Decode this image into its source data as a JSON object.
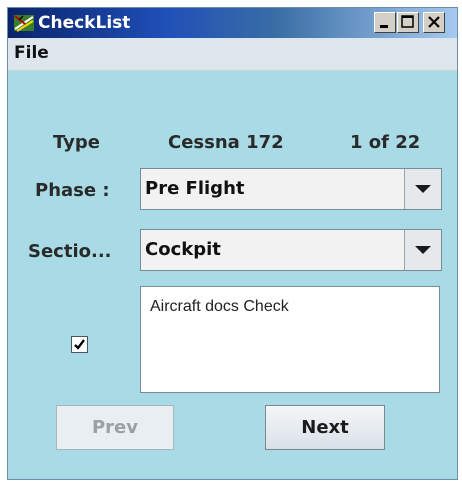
{
  "window": {
    "title": "CheckList",
    "buttons": {
      "minimize": "minimize-icon",
      "maximize": "maximize-icon",
      "close": "close-icon"
    }
  },
  "menu": {
    "file": "File"
  },
  "info": {
    "type_label": "Type",
    "aircraft": "Cessna 172",
    "progress": "1 of 22"
  },
  "phase": {
    "label": "Phase :",
    "value": "Pre Flight"
  },
  "section": {
    "label": "Sectio...",
    "value": "Cockpit"
  },
  "item": {
    "checked": true,
    "text": "Aircraft docs Check"
  },
  "nav": {
    "prev": "Prev",
    "next": "Next",
    "prev_enabled": false
  },
  "colors": {
    "panel": "#a9dbe6",
    "title_start": "#0a246a",
    "title_end": "#a6caf0"
  }
}
